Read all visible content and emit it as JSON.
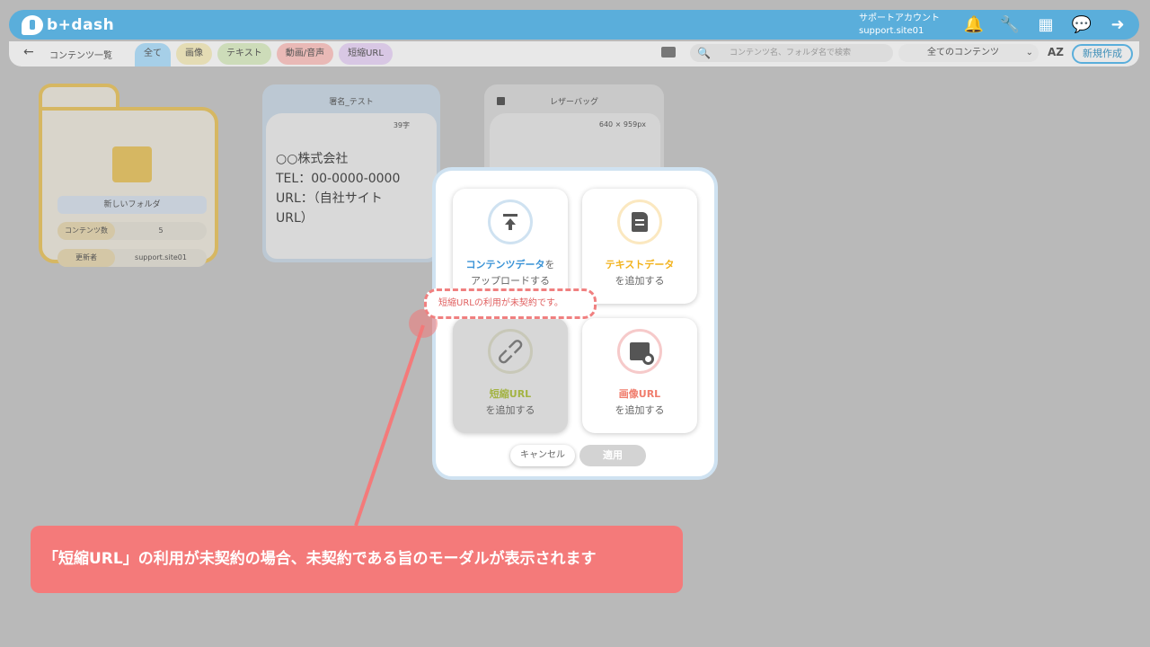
{
  "header": {
    "brand": "b+dash",
    "account_name": "サポートアカウント",
    "account_id": "support.site01"
  },
  "subbar": {
    "back_label": "←",
    "breadcrumb": "コンテンツ一覧",
    "tabs": [
      "全て",
      "画像",
      "テキスト",
      "動画/音声",
      "短縮URL"
    ],
    "search_placeholder": "コンテンツ名、フォルダ名で検索",
    "filter_selected": "全てのコンテンツ",
    "sort_label": "AZ",
    "new_button": "新規作成"
  },
  "folder": {
    "name": "新しいフォルダ",
    "count_label": "コンテンツ数",
    "count_value": "5",
    "updater_label": "更新者",
    "updater_value": "support.site01"
  },
  "text_card": {
    "title": "署名_テスト",
    "char_count": "39字",
    "body": "○○株式会社\nTEL：00-0000-0000\nURL：（自社サイト\nURL）"
  },
  "image_card": {
    "title": "レザーバッグ",
    "size": "640 × 959px"
  },
  "modal": {
    "options": [
      {
        "line1": "コンテンツデータ",
        "line1_suffix": "を",
        "line2": "アップロードする"
      },
      {
        "line1": "テキストデータ",
        "line2": "を追加する"
      },
      {
        "line1": "短縮URL",
        "line2": "を追加する"
      },
      {
        "line1": "画像URL",
        "line2": "を追加する"
      }
    ],
    "cancel_label": "キャンセル",
    "apply_label": "適用"
  },
  "tooltip": "短縮URLの利用が未契約です。",
  "callout": "「短縮URL」の利用が未契約の場合、未契約である旨のモーダルが表示されます",
  "colors": {
    "upload": "#3a93d6",
    "text": "#f2b21c",
    "shorturl": "#a3b343",
    "imageurl": "#f07c6c",
    "callout": "#f47a7a"
  }
}
